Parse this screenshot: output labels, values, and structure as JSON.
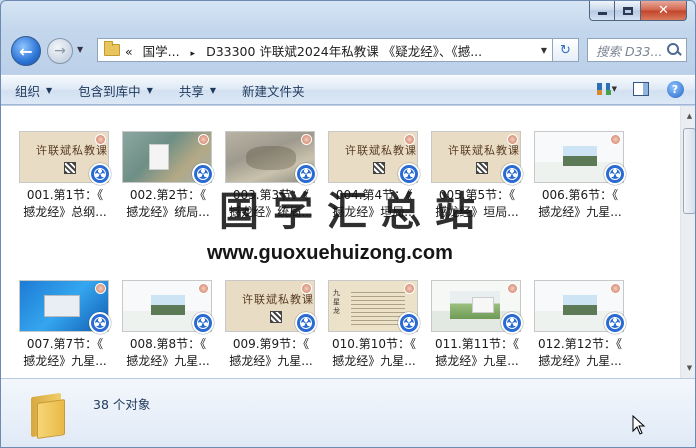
{
  "window": {
    "caption": {
      "minimize": "",
      "maximize": "",
      "close": "✕"
    }
  },
  "nav": {
    "back": "←",
    "forward": "→",
    "history": "▼"
  },
  "address": {
    "overflow": "«",
    "crumb1": "国学...",
    "separator": "▸",
    "crumb2": "D33300 许联斌2024年私教课 《疑龙经》、《撼...",
    "dropdown": "▼",
    "refresh": "↻"
  },
  "search": {
    "placeholder": "搜索 D33..."
  },
  "toolbar": {
    "organize": "组织",
    "include_library": "包含到库中",
    "share": "共享",
    "new_folder": "新建文件夹",
    "dropdown_arrow": "▼",
    "help": "?"
  },
  "files": [
    {
      "line1": "001.第1节：《",
      "line2": "撼龙经》总纲...",
      "thumb": "scroll",
      "thumb_title": "许联斌私教课"
    },
    {
      "line1": "002.第2节：《",
      "line2": "撼龙经》统局...",
      "thumb": "map"
    },
    {
      "line1": "003.第3节：《",
      "line2": "撼龙经》统局...",
      "thumb": "terrain"
    },
    {
      "line1": "004.第4节：《",
      "line2": "撼龙经》垣局...",
      "thumb": "scroll",
      "thumb_title": "许联斌私教课"
    },
    {
      "line1": "005.第5节：《",
      "line2": "撼龙经》垣局...",
      "thumb": "scroll",
      "thumb_title": "许联斌私教课"
    },
    {
      "line1": "006.第6节：《",
      "line2": "撼龙经》九星...",
      "thumb": "landscape"
    },
    {
      "line1": "007.第7节：《",
      "line2": "撼龙经》九星...",
      "thumb": "desktop"
    },
    {
      "line1": "008.第8节：《",
      "line2": "撼龙经》九星...",
      "thumb": "landscape"
    },
    {
      "line1": "009.第9节：《",
      "line2": "撼龙经》九星...",
      "thumb": "scroll",
      "thumb_title": "许联斌私教课"
    },
    {
      "line1": "010.第10节：《",
      "line2": "撼龙经》九星...",
      "thumb": "text",
      "thumb_side": "九星龙"
    },
    {
      "line1": "011.第11节：《",
      "line2": "撼龙经》九星...",
      "thumb": "photo"
    },
    {
      "line1": "012.第12节：《",
      "line2": "撼龙经》九星...",
      "thumb": "landscape"
    }
  ],
  "watermark": {
    "cn": "国学汇总站",
    "url": "www.guoxuehuizong.com"
  },
  "status": {
    "count": "38 个对象"
  },
  "colors": {
    "accent": "#2a6bd2",
    "toolbar_text": "#1e395b",
    "close": "#c1432a"
  }
}
